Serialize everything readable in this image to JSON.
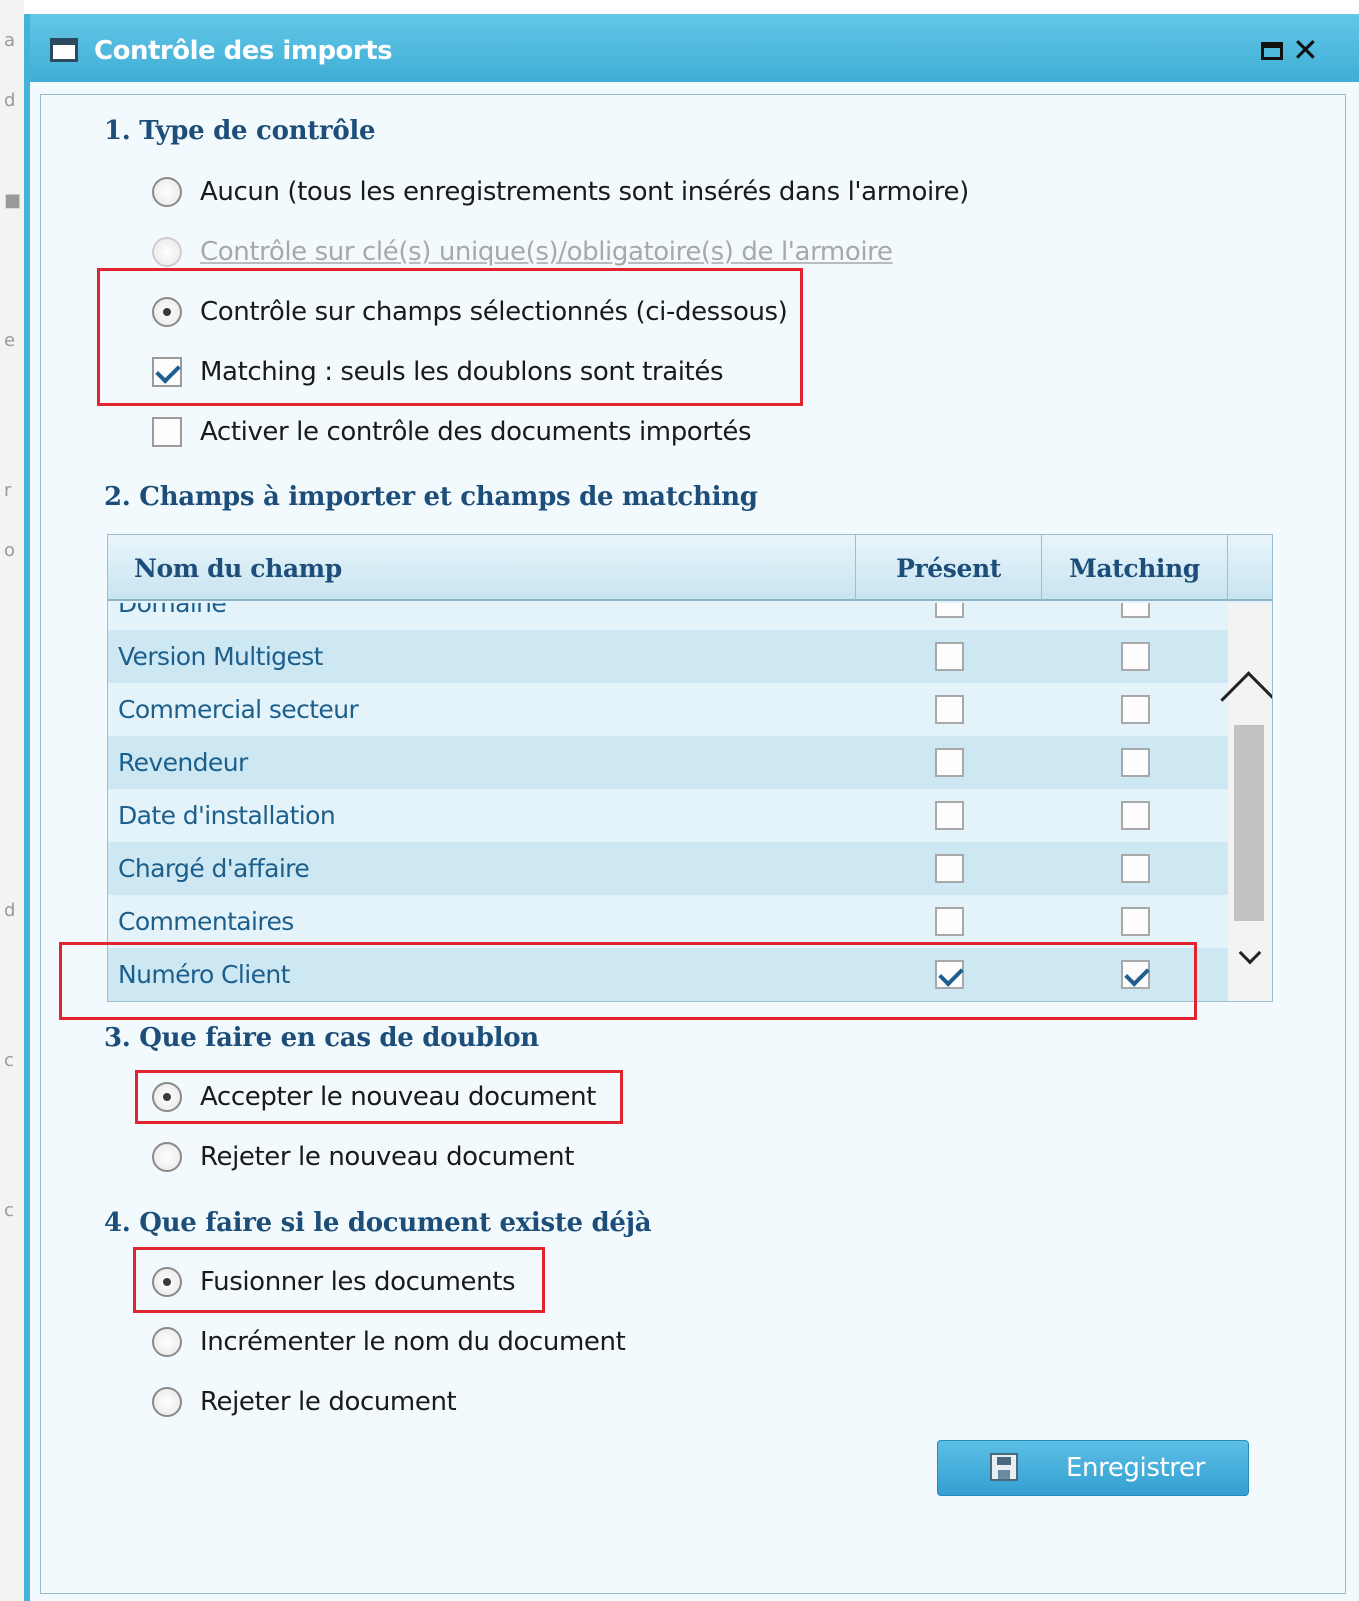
{
  "window": {
    "title": "Contrôle des imports"
  },
  "section1": {
    "heading": "1. Type de contrôle",
    "options": [
      {
        "label": "Aucun (tous les enregistrements sont insérés dans l'armoire)",
        "type": "radio",
        "checked": false,
        "disabled": false
      },
      {
        "label": "Contrôle sur clé(s) unique(s)/obligatoire(s) de l'armoire",
        "type": "radio",
        "checked": false,
        "disabled": true
      },
      {
        "label": "Contrôle sur champs sélectionnés (ci-dessous)",
        "type": "radio",
        "checked": true,
        "disabled": false
      },
      {
        "label": "Matching : seuls les doublons sont traités",
        "type": "checkbox",
        "checked": true,
        "disabled": false
      },
      {
        "label": "Activer le contrôle des documents importés",
        "type": "checkbox",
        "checked": false,
        "disabled": false
      }
    ]
  },
  "section2": {
    "heading": "2. Champs à importer et champs de matching",
    "columns": {
      "name": "Nom du champ",
      "present": "Présent",
      "matching": "Matching"
    },
    "rows": [
      {
        "name": "Domaine",
        "present": false,
        "matching": false
      },
      {
        "name": "Version Multigest",
        "present": false,
        "matching": false
      },
      {
        "name": "Commercial secteur",
        "present": false,
        "matching": false
      },
      {
        "name": "Revendeur",
        "present": false,
        "matching": false
      },
      {
        "name": "Date d'installation",
        "present": false,
        "matching": false
      },
      {
        "name": "Chargé d'affaire",
        "present": false,
        "matching": false
      },
      {
        "name": "Commentaires",
        "present": false,
        "matching": false
      },
      {
        "name": "Numéro Client",
        "present": true,
        "matching": true
      }
    ]
  },
  "section3": {
    "heading": "3. Que faire en cas de doublon",
    "options": [
      {
        "label": "Accepter le nouveau document",
        "checked": true
      },
      {
        "label": "Rejeter le nouveau document",
        "checked": false
      }
    ]
  },
  "section4": {
    "heading": "4. Que faire si le document existe déjà",
    "options": [
      {
        "label": "Fusionner les documents",
        "checked": true
      },
      {
        "label": "Incrémenter le nom du document",
        "checked": false
      },
      {
        "label": "Rejeter le document",
        "checked": false
      }
    ]
  },
  "footer": {
    "save_label": "Enregistrer"
  },
  "colors": {
    "accent": "#43b3d8",
    "heading": "#1d4e7a",
    "highlight": "#e2242e"
  }
}
